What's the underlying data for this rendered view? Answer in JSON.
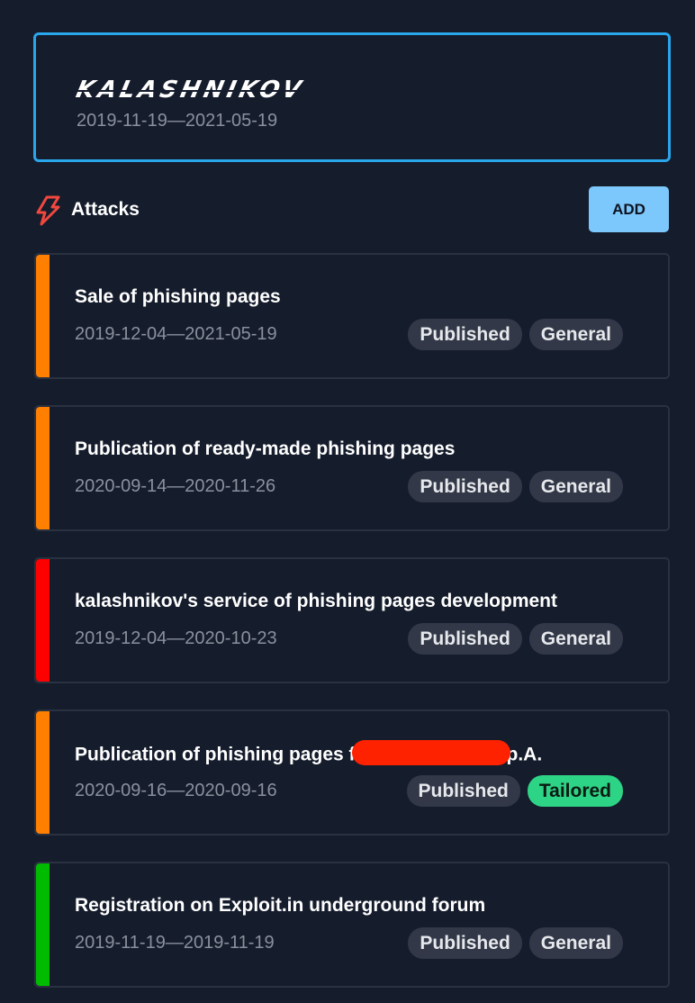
{
  "header": {
    "title": "KALASHNIKOV",
    "date_range": "2019-11-19—2021-05-19"
  },
  "section": {
    "title": "Attacks",
    "icon": "lightning-bolt-icon",
    "add_label": "ADD",
    "icon_color": "#f0483e"
  },
  "attacks": [
    {
      "title": "Sale of phishing pages",
      "date_range": "2019-12-04—2021-05-19",
      "status": "Published",
      "type": "General",
      "color": "#ff7f00"
    },
    {
      "title": "Publication of ready-made phishing pages",
      "date_range": "2020-09-14—2020-11-26",
      "status": "Published",
      "type": "General",
      "color": "#ff7f00"
    },
    {
      "title": "kalashnikov's service of phishing pages development",
      "date_range": "2019-12-04—2020-10-23",
      "status": "Published",
      "type": "General",
      "color": "#ff0000"
    },
    {
      "title_prefix": "Publication of phishing pages f",
      "title_suffix": "p.A.",
      "date_range": "2020-09-16—2020-09-16",
      "status": "Published",
      "type": "Tailored",
      "color": "#ff7f00",
      "type_color": "#2ed486"
    },
    {
      "title": "Registration on Exploit.in underground forum",
      "date_range": "2019-11-19—2019-11-19",
      "status": "Published",
      "type": "General",
      "color": "#00bb00"
    }
  ]
}
